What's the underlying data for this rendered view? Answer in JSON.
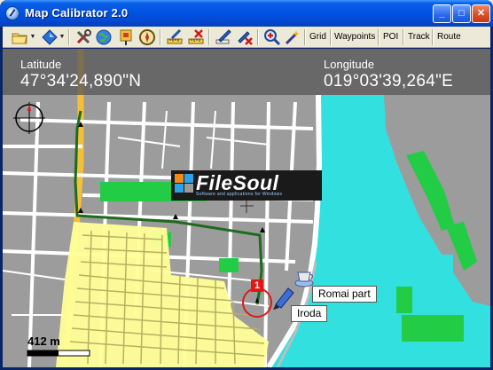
{
  "window": {
    "title": "Map Calibrator 2.0",
    "controls": {
      "minimize": "_",
      "maximize": "□",
      "close": "✕"
    }
  },
  "toolbar": {
    "icons": [
      "open-folder-icon",
      "navigate-diamond-icon",
      "tools-icon",
      "globe-icon",
      "pin-flag-icon",
      "compass-icon",
      "ruler-pencil-icon",
      "ruler-delete-icon",
      "edit-pencil-icon",
      "pencil-delete-icon",
      "zoom-in-icon",
      "magic-wand-icon"
    ],
    "buttons": [
      {
        "label": "Grid"
      },
      {
        "label": "Waypoints"
      },
      {
        "label": "POI"
      },
      {
        "label": "Track"
      },
      {
        "label": "Route"
      }
    ]
  },
  "coordinates": {
    "latitude_label": "Latitude",
    "latitude_value": "47°34'24,890\"N",
    "longitude_label": "Longitude",
    "longitude_value": "019°03'39,264\"E"
  },
  "pois": [
    {
      "label": "Romai part",
      "icon": "coffee-cup-icon"
    },
    {
      "label": "Iroda",
      "icon": "pen-icon"
    }
  ],
  "waypoint_badge": "1",
  "scale": {
    "label": "412 m"
  },
  "watermark": {
    "title": "FileSoul",
    "subtitle": "Software and applications for Windows"
  },
  "colors": {
    "river": "#33e0e0",
    "park": "#22cc44",
    "track": "#227722",
    "road": "#ffffff",
    "highway": "#ffcc44",
    "built_area": "#ffff99"
  }
}
